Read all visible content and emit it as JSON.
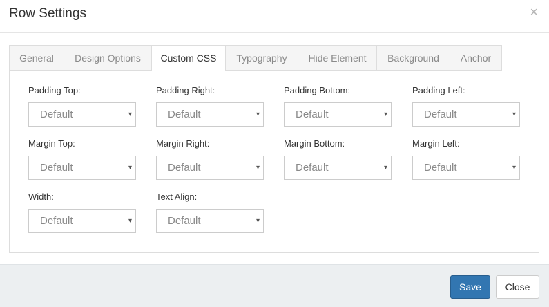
{
  "dialog": {
    "title": "Row Settings",
    "close_glyph": "×"
  },
  "tabs": [
    {
      "label": "General"
    },
    {
      "label": "Design Options"
    },
    {
      "label": "Custom CSS"
    },
    {
      "label": "Typography"
    },
    {
      "label": "Hide Element"
    },
    {
      "label": "Background"
    },
    {
      "label": "Anchor"
    }
  ],
  "active_tab": "Custom CSS",
  "fields": {
    "padding_top": {
      "label": "Padding Top:",
      "value": "Default"
    },
    "padding_right": {
      "label": "Padding Right:",
      "value": "Default"
    },
    "padding_bottom": {
      "label": "Padding Bottom:",
      "value": "Default"
    },
    "padding_left": {
      "label": "Padding Left:",
      "value": "Default"
    },
    "margin_top": {
      "label": "Margin Top:",
      "value": "Default"
    },
    "margin_right": {
      "label": "Margin Right:",
      "value": "Default"
    },
    "margin_bottom": {
      "label": "Margin Bottom:",
      "value": "Default"
    },
    "margin_left": {
      "label": "Margin Left:",
      "value": "Default"
    },
    "width": {
      "label": "Width:",
      "value": "Default"
    },
    "text_align": {
      "label": "Text Align:",
      "value": "Default"
    }
  },
  "caret_glyph": "▾",
  "footer": {
    "save_label": "Save",
    "close_label": "Close"
  },
  "colors": {
    "primary": "#3276b1",
    "footer_bg": "#eceff1",
    "border": "#dddddd"
  }
}
